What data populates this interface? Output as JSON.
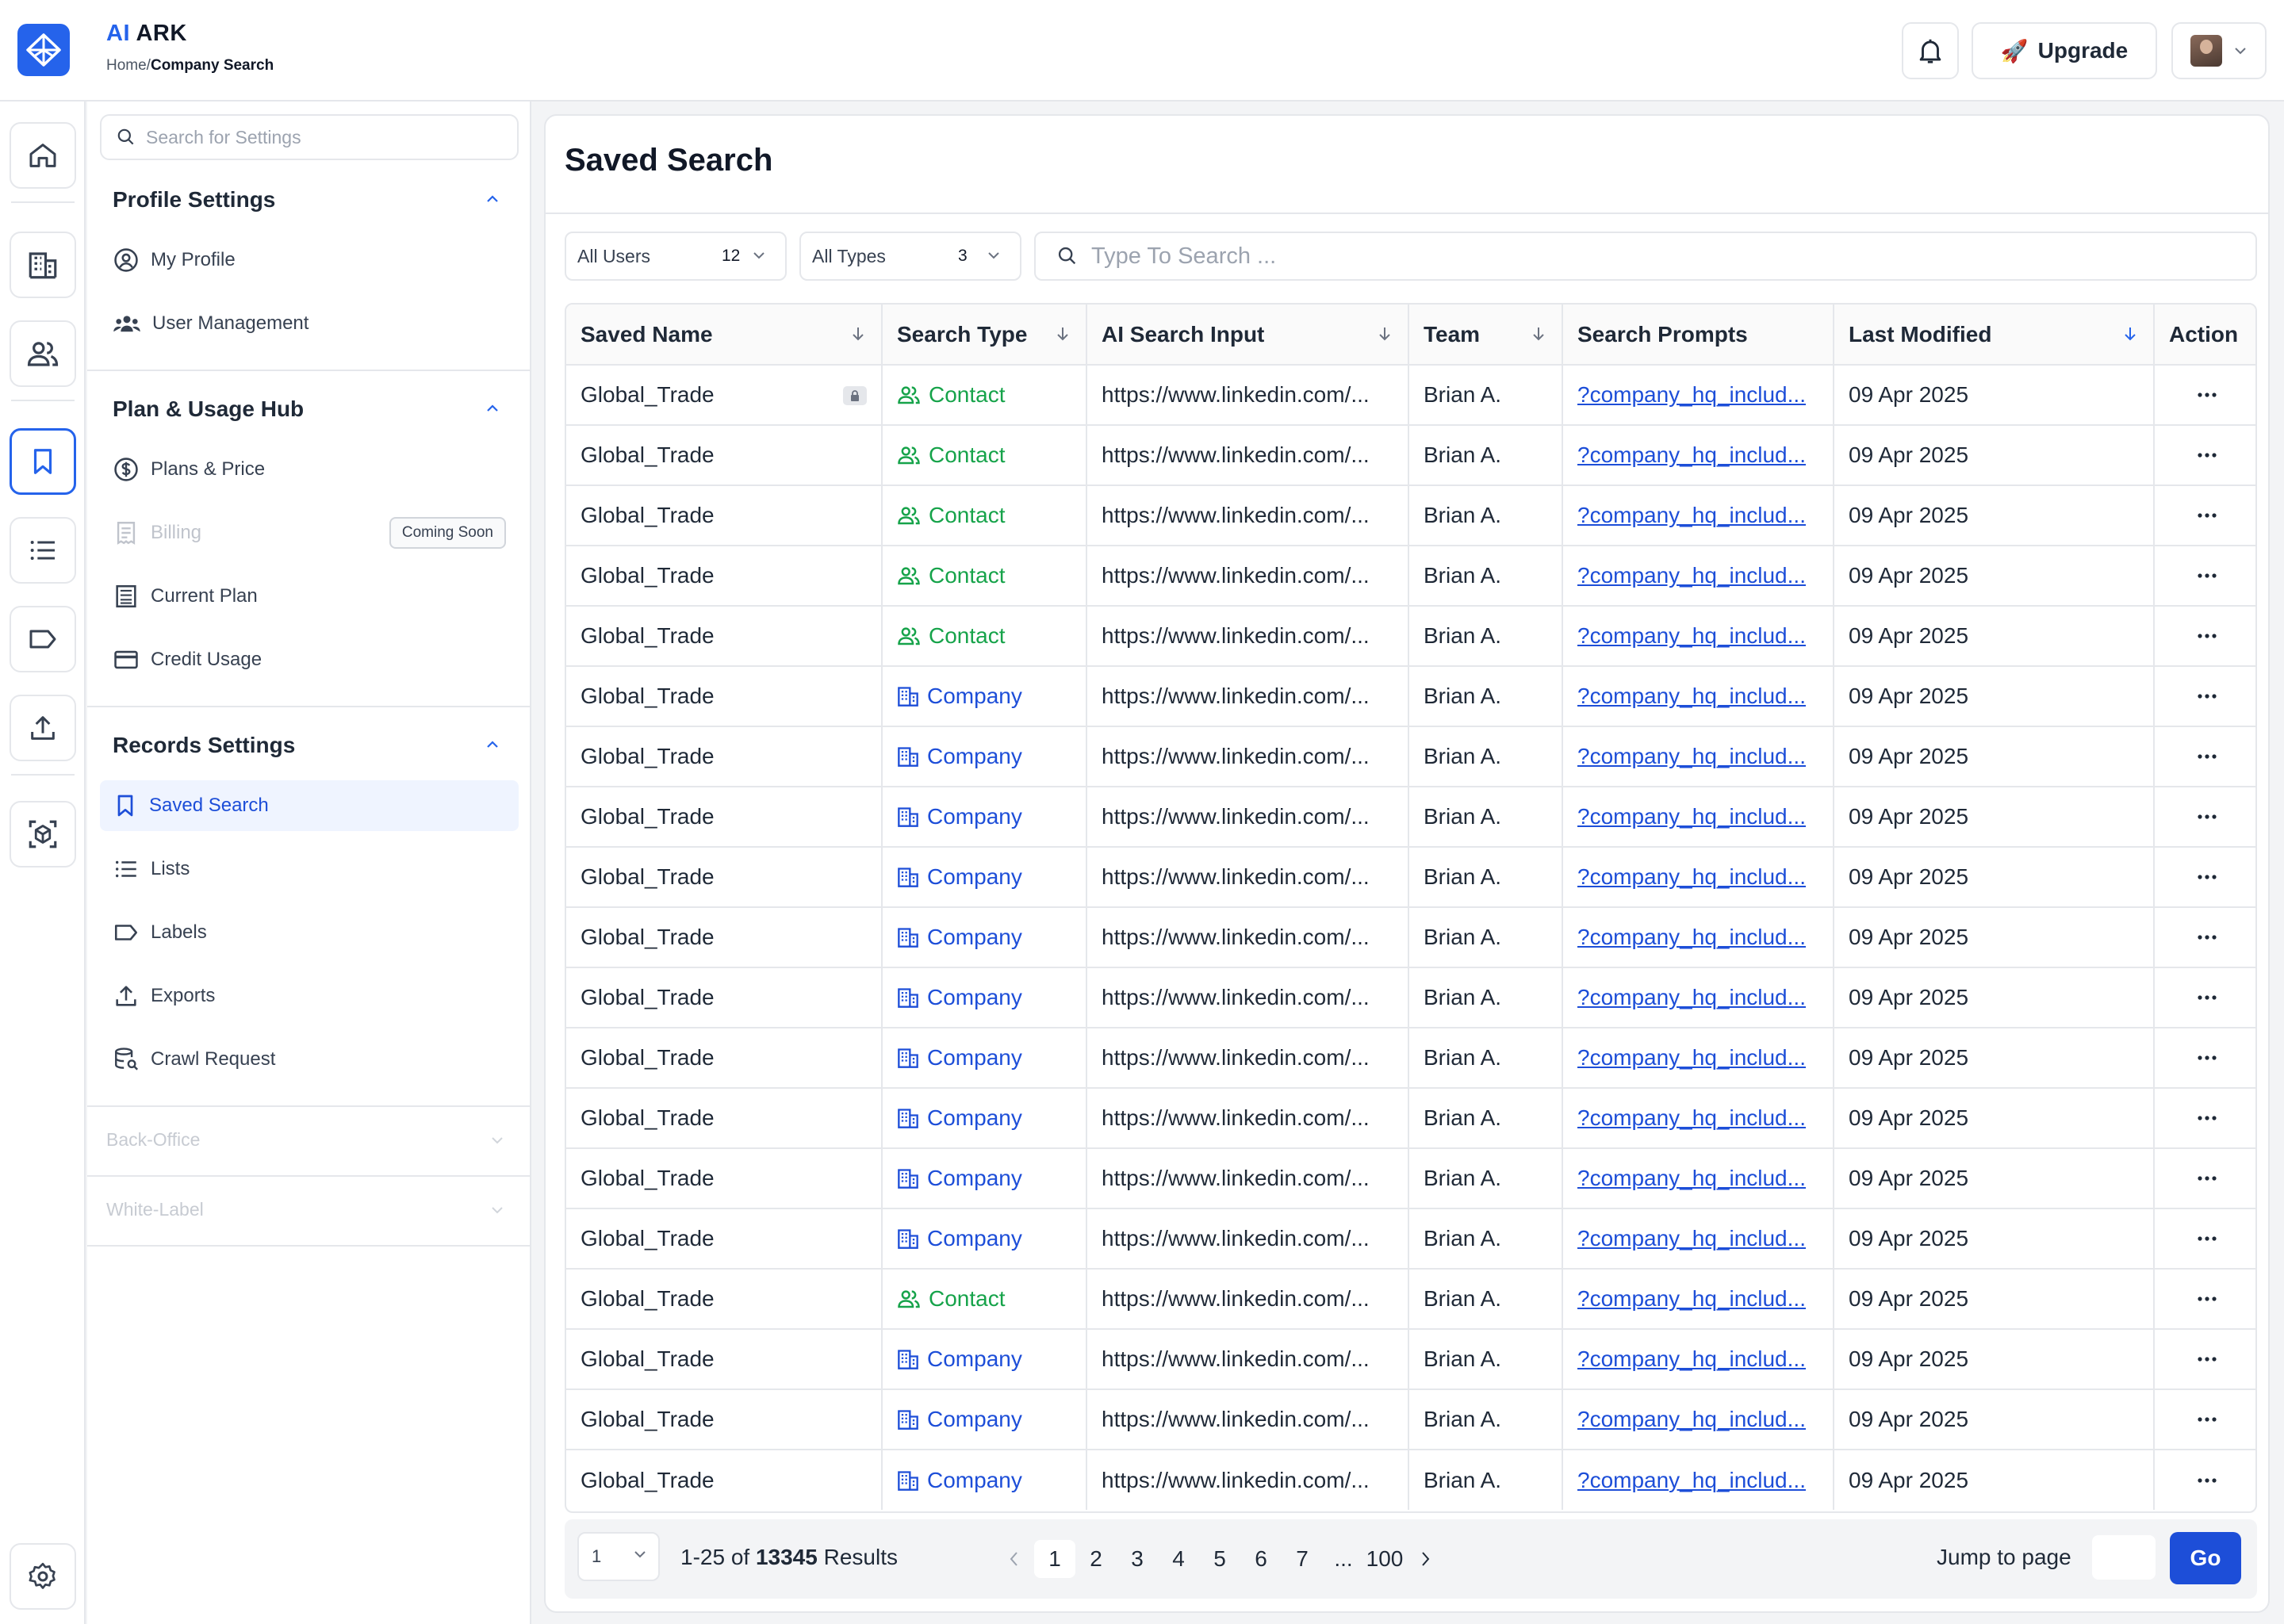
{
  "app": {
    "brand_ai": "AI",
    "brand_rest": " ARK"
  },
  "breadcrumb": {
    "home": "Home/",
    "current": "Company Search"
  },
  "header": {
    "upgrade_label": "Upgrade",
    "upgrade_emoji": "🚀"
  },
  "settings": {
    "search_placeholder": "Search for Settings",
    "profile_title": "Profile Settings",
    "my_profile": "My Profile",
    "user_management": "User Management",
    "plan_title": "Plan & Usage Hub",
    "plans_price": "Plans & Price",
    "billing": "Billing",
    "coming_soon": "Coming Soon",
    "current_plan": "Current Plan",
    "credit_usage": "Credit Usage",
    "records_title": "Records Settings",
    "saved_search": "Saved Search",
    "lists": "Lists",
    "labels": "Labels",
    "exports": "Exports",
    "crawl_request": "Crawl Request",
    "back_office": "Back-Office",
    "white_label": "White-Label"
  },
  "main": {
    "title": "Saved Search",
    "filter_users": {
      "label": "All Users",
      "count": "12"
    },
    "filter_types": {
      "label": "All Types",
      "count": "3"
    },
    "search_placeholder": "Type To Search ..."
  },
  "table": {
    "columns": [
      "Saved Name",
      "Search Type",
      "AI Search Input",
      "Team",
      "Search Prompts",
      "Last Modified",
      "Action"
    ],
    "rows": [
      {
        "name": "Global_Trade",
        "type": "Contact",
        "input": "https://www.linkedin.com/...",
        "team": "Brian A.",
        "prompt": "?company_hq_includ...",
        "modified": "09 Apr 2025",
        "locked": true
      },
      {
        "name": "Global_Trade",
        "type": "Contact",
        "input": "https://www.linkedin.com/...",
        "team": "Brian A.",
        "prompt": "?company_hq_includ...",
        "modified": "09 Apr 2025"
      },
      {
        "name": "Global_Trade",
        "type": "Contact",
        "input": "https://www.linkedin.com/...",
        "team": "Brian A.",
        "prompt": "?company_hq_includ...",
        "modified": "09 Apr 2025"
      },
      {
        "name": "Global_Trade",
        "type": "Contact",
        "input": "https://www.linkedin.com/...",
        "team": "Brian A.",
        "prompt": "?company_hq_includ...",
        "modified": "09 Apr 2025"
      },
      {
        "name": "Global_Trade",
        "type": "Contact",
        "input": "https://www.linkedin.com/...",
        "team": "Brian A.",
        "prompt": "?company_hq_includ...",
        "modified": "09 Apr 2025"
      },
      {
        "name": "Global_Trade",
        "type": "Company",
        "input": "https://www.linkedin.com/...",
        "team": "Brian A.",
        "prompt": "?company_hq_includ...",
        "modified": "09 Apr 2025"
      },
      {
        "name": "Global_Trade",
        "type": "Company",
        "input": "https://www.linkedin.com/...",
        "team": "Brian A.",
        "prompt": "?company_hq_includ...",
        "modified": "09 Apr 2025"
      },
      {
        "name": "Global_Trade",
        "type": "Company",
        "input": "https://www.linkedin.com/...",
        "team": "Brian A.",
        "prompt": "?company_hq_includ...",
        "modified": "09 Apr 2025"
      },
      {
        "name": "Global_Trade",
        "type": "Company",
        "input": "https://www.linkedin.com/...",
        "team": "Brian A.",
        "prompt": "?company_hq_includ...",
        "modified": "09 Apr 2025"
      },
      {
        "name": "Global_Trade",
        "type": "Company",
        "input": "https://www.linkedin.com/...",
        "team": "Brian A.",
        "prompt": "?company_hq_includ...",
        "modified": "09 Apr 2025"
      },
      {
        "name": "Global_Trade",
        "type": "Company",
        "input": "https://www.linkedin.com/...",
        "team": "Brian A.",
        "prompt": "?company_hq_includ...",
        "modified": "09 Apr 2025"
      },
      {
        "name": "Global_Trade",
        "type": "Company",
        "input": "https://www.linkedin.com/...",
        "team": "Brian A.",
        "prompt": "?company_hq_includ...",
        "modified": "09 Apr 2025"
      },
      {
        "name": "Global_Trade",
        "type": "Company",
        "input": "https://www.linkedin.com/...",
        "team": "Brian A.",
        "prompt": "?company_hq_includ...",
        "modified": "09 Apr 2025"
      },
      {
        "name": "Global_Trade",
        "type": "Company",
        "input": "https://www.linkedin.com/...",
        "team": "Brian A.",
        "prompt": "?company_hq_includ...",
        "modified": "09 Apr 2025"
      },
      {
        "name": "Global_Trade",
        "type": "Company",
        "input": "https://www.linkedin.com/...",
        "team": "Brian A.",
        "prompt": "?company_hq_includ...",
        "modified": "09 Apr 2025"
      },
      {
        "name": "Global_Trade",
        "type": "Contact",
        "input": "https://www.linkedin.com/...",
        "team": "Brian A.",
        "prompt": "?company_hq_includ...",
        "modified": "09 Apr 2025"
      },
      {
        "name": "Global_Trade",
        "type": "Company",
        "input": "https://www.linkedin.com/...",
        "team": "Brian A.",
        "prompt": "?company_hq_includ...",
        "modified": "09 Apr 2025"
      },
      {
        "name": "Global_Trade",
        "type": "Company",
        "input": "https://www.linkedin.com/...",
        "team": "Brian A.",
        "prompt": "?company_hq_includ...",
        "modified": "09 Apr 2025"
      },
      {
        "name": "Global_Trade",
        "type": "Company",
        "input": "https://www.linkedin.com/...",
        "team": "Brian A.",
        "prompt": "?company_hq_includ...",
        "modified": "09 Apr 2025"
      }
    ]
  },
  "pagination": {
    "per_page_value": "1",
    "range": "1-25 of ",
    "total": "13345",
    "results_suffix": " Results",
    "pages": [
      "1",
      "2",
      "3",
      "4",
      "5",
      "6",
      "7",
      "...",
      "100"
    ],
    "current_page": "1",
    "jump_label": "Jump to page",
    "go_label": "Go"
  },
  "colors": {
    "accent": "#2563eb",
    "contact": "#16a34a",
    "company": "#1d4ed8"
  }
}
